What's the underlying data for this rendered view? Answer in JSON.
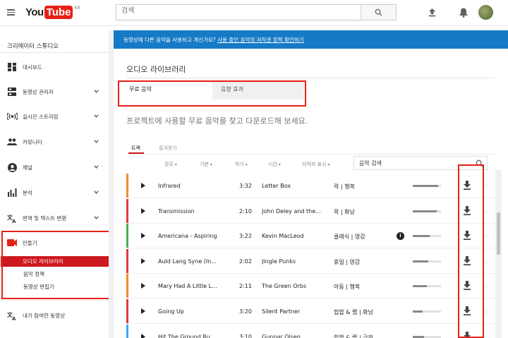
{
  "topbar": {
    "logo_you": "You",
    "logo_tube": "Tube",
    "logo_region": "KR",
    "search_placeholder": "검색"
  },
  "sidebar": {
    "title": "크리에이터 스튜디오",
    "items": [
      {
        "label": "대시보드",
        "icon": "dashboard-icon"
      },
      {
        "label": "동영상 관리자",
        "icon": "video-manager-icon"
      },
      {
        "label": "실시간 스트리밍",
        "icon": "live-icon"
      },
      {
        "label": "커뮤니티",
        "icon": "community-icon"
      },
      {
        "label": "채널",
        "icon": "channel-icon"
      },
      {
        "label": "분석",
        "icon": "analytics-icon"
      },
      {
        "label": "번역 및 텍스트 변환",
        "icon": "translate-icon"
      },
      {
        "label": "만들기",
        "icon": "create-icon"
      }
    ],
    "create_sub": [
      "오디오 라이브러리",
      "음악 정책",
      "동영상 편집기"
    ],
    "contrib": "내가 참여한 동영상"
  },
  "banner": {
    "text": "동영상에 다른 음악을 사용하고 계신가요? ",
    "link": "사용 중인 음악의 저작권 정책 확인하기"
  },
  "page_title": "오디오 라이브러리",
  "tabs": [
    "무료 음악",
    "음향 효과"
  ],
  "subtitle": "프로젝트에 사용할 무료 음악을 찾고 다운로드해 보세요.",
  "subtabs": [
    "트랙",
    "즐겨찾기"
  ],
  "filters": [
    "장르",
    "기분",
    "악기",
    "시간",
    "저작자 표시"
  ],
  "music_search_placeholder": "음악 검색",
  "tracks": [
    {
      "title": "Infrared",
      "duration": "3:32",
      "artist": "Letter Box",
      "genre": "락 | 행복",
      "popularity": 0.9,
      "attribution": false,
      "color": "#f28c28"
    },
    {
      "title": "Transmission",
      "duration": "2:10",
      "artist": "John Deley and the...",
      "genre": "락 | 화남",
      "popularity": 0.85,
      "attribution": false,
      "color": "#e23b3b"
    },
    {
      "title": "Americana - Aspiring",
      "duration": "3:22",
      "artist": "Kevin MacLeod",
      "genre": "클래식 | 영감",
      "popularity": 0.6,
      "attribution": true,
      "color": "#4caf50"
    },
    {
      "title": "Auld Lang Syne (In...",
      "duration": "2:02",
      "artist": "Jingle Punks",
      "genre": "휴일 | 영감",
      "popularity": 0.55,
      "attribution": false,
      "color": "#e23b3b"
    },
    {
      "title": "Mary Had A Little L...",
      "duration": "2:11",
      "artist": "The Green Orbs",
      "genre": "아동 | 행복",
      "popularity": 0.5,
      "attribution": false,
      "color": "#f28c28"
    },
    {
      "title": "Going Up",
      "duration": "3:20",
      "artist": "Silent Partner",
      "genre": "힙합 & 랩 | 화남",
      "popularity": 0.35,
      "attribution": false,
      "color": "#e23b3b"
    },
    {
      "title": "Hit The Ground Ru...",
      "duration": "3:10",
      "artist": "Gunnar Olsen",
      "genre": "힙합 & 랩 | 극적",
      "popularity": 0.4,
      "attribution": false,
      "color": "#42a5f5"
    }
  ]
}
